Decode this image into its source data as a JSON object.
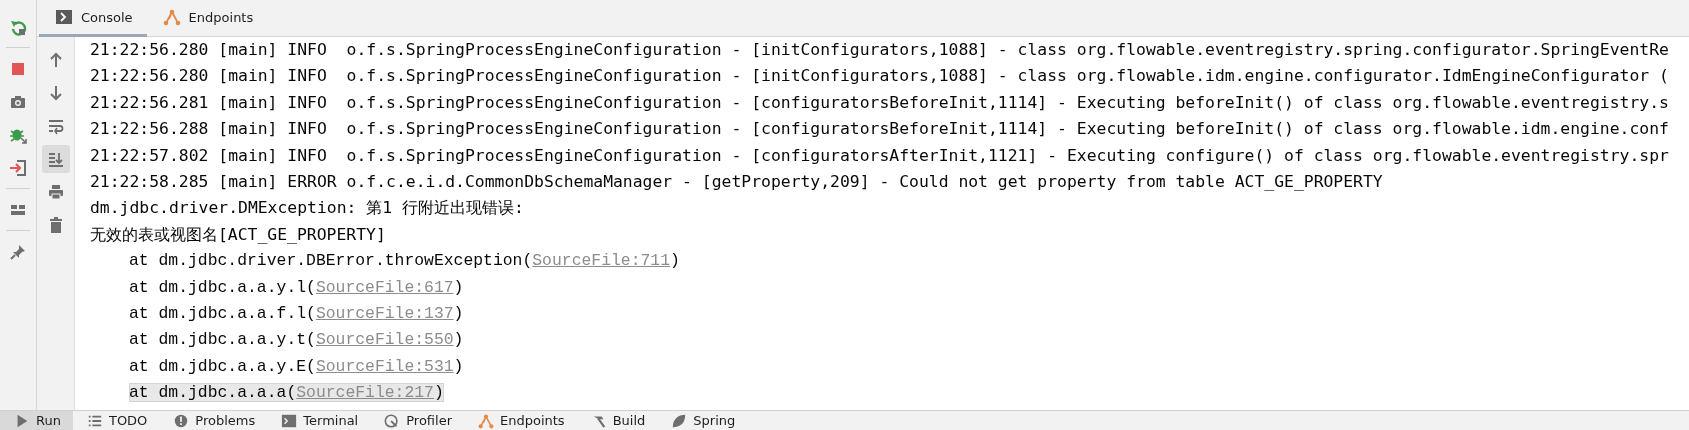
{
  "run_toolbar": [
    {
      "kind": "rerun"
    },
    {
      "kind": "stop"
    },
    {
      "kind": "camera"
    },
    {
      "kind": "debug"
    },
    {
      "kind": "import"
    },
    {
      "kind": "layout"
    },
    {
      "kind": "pin"
    }
  ],
  "tabs": [
    {
      "label": "Console",
      "kind": "console",
      "selected": true
    },
    {
      "label": "Endpoints",
      "kind": "endpoints",
      "selected": false
    }
  ],
  "console_toolbar": [
    {
      "kind": "up",
      "selected": false
    },
    {
      "kind": "down",
      "selected": false
    },
    {
      "kind": "wrap",
      "selected": false
    },
    {
      "kind": "scroll-end",
      "selected": true
    },
    {
      "kind": "print",
      "selected": false
    },
    {
      "kind": "trash",
      "selected": false
    }
  ],
  "log_lines": [
    {
      "kind": "log",
      "text": "21:22:56.280 [main] INFO  o.f.s.SpringProcessEngineConfiguration - [initConfigurators,1088] - class org.flowable.eventregistry.spring.configurator.SpringEventRe"
    },
    {
      "kind": "log",
      "text": "21:22:56.280 [main] INFO  o.f.s.SpringProcessEngineConfiguration - [initConfigurators,1088] - class org.flowable.idm.engine.configurator.IdmEngineConfigurator ("
    },
    {
      "kind": "log",
      "text": "21:22:56.281 [main] INFO  o.f.s.SpringProcessEngineConfiguration - [configuratorsBeforeInit,1114] - Executing beforeInit() of class org.flowable.eventregistry.s"
    },
    {
      "kind": "log",
      "text": "21:22:56.288 [main] INFO  o.f.s.SpringProcessEngineConfiguration - [configuratorsBeforeInit,1114] - Executing beforeInit() of class org.flowable.idm.engine.conf"
    },
    {
      "kind": "log",
      "text": "21:22:57.802 [main] INFO  o.f.s.SpringProcessEngineConfiguration - [configuratorsAfterInit,1121] - Executing configure() of class org.flowable.eventregistry.spr"
    },
    {
      "kind": "log",
      "text": "21:22:58.285 [main] ERROR o.f.c.e.i.d.CommonDbSchemaManager - [getProperty,209] - Could not get property from table ACT_GE_PROPERTY"
    },
    {
      "kind": "log",
      "text": "dm.jdbc.driver.DMException: 第1 行附近出现错误:"
    },
    {
      "kind": "log",
      "text": "无效的表或视图名[ACT_GE_PROPERTY]"
    },
    {
      "kind": "trace",
      "text": "at dm.jdbc.driver.DBError.throwException(",
      "link": "SourceFile:711",
      "suffix": ")",
      "selected": false
    },
    {
      "kind": "trace",
      "text": "at dm.jdbc.a.a.y.l(",
      "link": "SourceFile:617",
      "suffix": ")",
      "selected": false
    },
    {
      "kind": "trace",
      "text": "at dm.jdbc.a.a.f.l(",
      "link": "SourceFile:137",
      "suffix": ")",
      "selected": false
    },
    {
      "kind": "trace",
      "text": "at dm.jdbc.a.a.y.t(",
      "link": "SourceFile:550",
      "suffix": ")",
      "selected": false
    },
    {
      "kind": "trace",
      "text": "at dm.jdbc.a.a.y.E(",
      "link": "SourceFile:531",
      "suffix": ")",
      "selected": false
    },
    {
      "kind": "trace",
      "text": "at dm.jdbc.a.a.a(",
      "link": "SourceFile:217",
      "suffix": ")",
      "selected": true
    }
  ],
  "bottom_tabs": [
    {
      "label": "Run",
      "kind": "run",
      "selected": true
    },
    {
      "label": "TODO",
      "kind": "todo",
      "selected": false
    },
    {
      "label": "Problems",
      "kind": "problems",
      "selected": false
    },
    {
      "label": "Terminal",
      "kind": "terminal",
      "selected": false
    },
    {
      "label": "Profiler",
      "kind": "profiler",
      "selected": false
    },
    {
      "label": "Endpoints",
      "kind": "endpoints",
      "selected": false
    },
    {
      "label": "Build",
      "kind": "build",
      "selected": false
    },
    {
      "label": "Spring",
      "kind": "spring",
      "selected": false
    }
  ]
}
